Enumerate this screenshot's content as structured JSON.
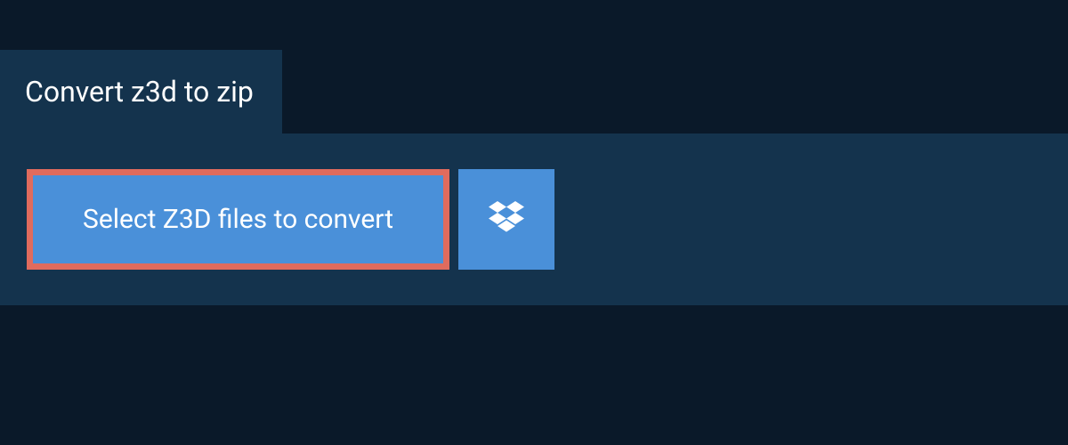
{
  "header": {
    "title": "Convert z3d to zip"
  },
  "actions": {
    "select_files_label": "Select Z3D files to convert"
  },
  "icons": {
    "dropbox": "dropbox-icon"
  },
  "colors": {
    "background": "#0a1929",
    "panel": "#14334d",
    "button": "#4a90d9",
    "highlight_border": "#e06b5d",
    "text": "#ffffff"
  }
}
